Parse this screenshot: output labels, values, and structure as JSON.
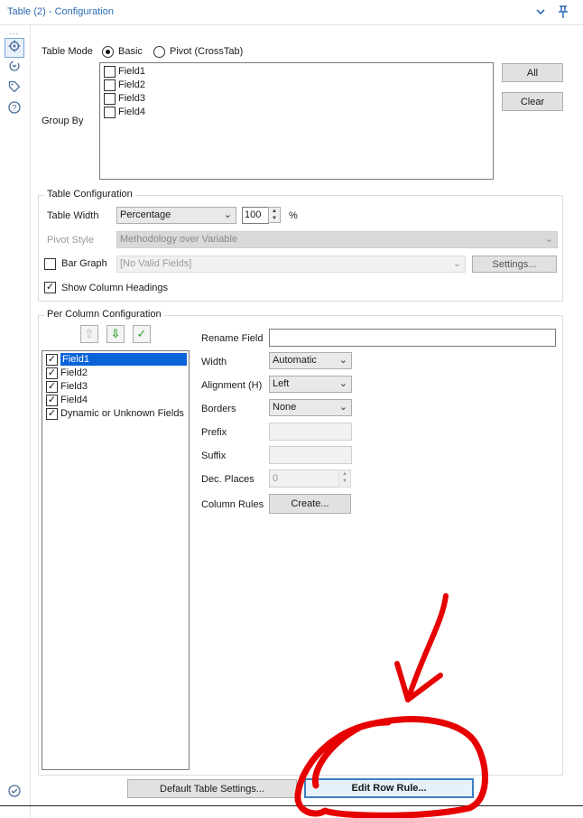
{
  "header": {
    "title": "Table (2) - Configuration"
  },
  "rail": {
    "dots": "..."
  },
  "table_mode": {
    "label": "Table Mode",
    "options": [
      "Basic",
      "Pivot (CrossTab)"
    ],
    "selected": "Basic"
  },
  "group_by": {
    "label": "Group By",
    "fields": [
      "Field1",
      "Field2",
      "Field3",
      "Field4"
    ],
    "all_label": "All",
    "clear_label": "Clear"
  },
  "table_config": {
    "legend": "Table Configuration",
    "width_label": "Table Width",
    "width_mode": "Percentage",
    "width_value": "100",
    "width_unit": "%",
    "pivot_style_label": "Pivot Style",
    "pivot_style_value": "Methodology over Variable",
    "bar_graph_label": "Bar Graph",
    "bar_graph_value": "[No Valid Fields]",
    "settings_label": "Settings...",
    "show_headings_label": "Show Column Headings"
  },
  "per_column": {
    "legend": "Per Column Configuration",
    "fields": [
      {
        "label": "Field1",
        "checked": true,
        "selected": true
      },
      {
        "label": "Field2",
        "checked": true,
        "selected": false
      },
      {
        "label": "Field3",
        "checked": true,
        "selected": false
      },
      {
        "label": "Field4",
        "checked": true,
        "selected": false
      },
      {
        "label": "Dynamic or Unknown Fields",
        "checked": true,
        "selected": false
      }
    ],
    "rename_label": "Rename Field",
    "rename_value": "",
    "width_label": "Width",
    "width_value": "Automatic",
    "alignment_label": "Alignment (H)",
    "alignment_value": "Left",
    "borders_label": "Borders",
    "borders_value": "None",
    "prefix_label": "Prefix",
    "suffix_label": "Suffix",
    "dec_label": "Dec. Places",
    "dec_value": "0",
    "column_rules_label": "Column Rules",
    "create_label": "Create..."
  },
  "footer": {
    "default_settings_label": "Default Table Settings...",
    "edit_row_rule_label": "Edit Row Rule..."
  },
  "colors": {
    "accent": "#2b6cb3",
    "annotation": "#e60000",
    "selection": "#0a64d8"
  },
  "icons": [
    "chevron-down-icon",
    "pin-icon",
    "gear-icon",
    "refresh-icon",
    "tag-icon",
    "help-icon",
    "check-circle-icon",
    "arrow-up-icon",
    "arrow-down-icon",
    "checkmark-icon"
  ]
}
